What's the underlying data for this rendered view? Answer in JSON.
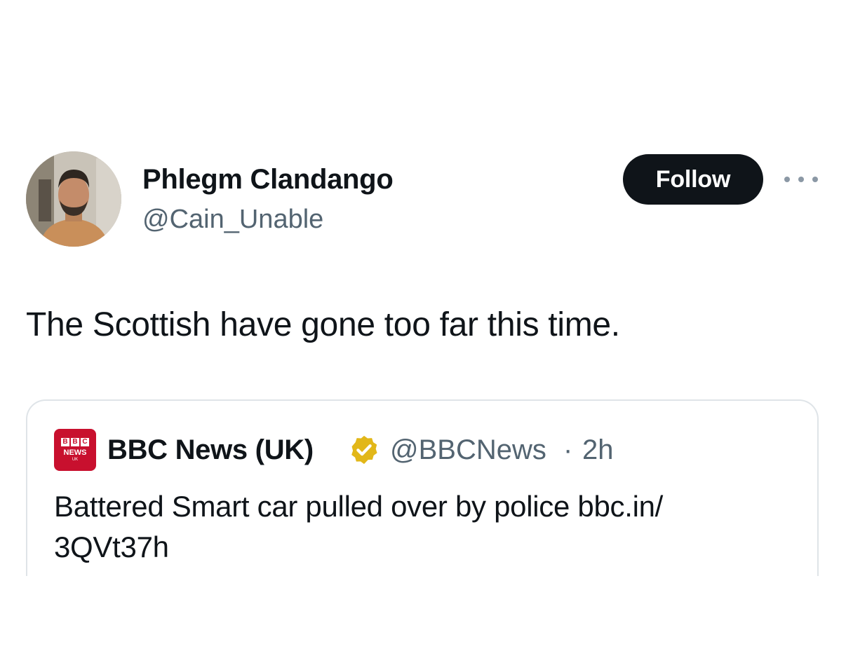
{
  "tweet": {
    "author": {
      "name": "Phlegm Clandango",
      "handle": "@Cain_Unable"
    },
    "follow_label": "Follow",
    "more_icon": "more-horizontal-icon",
    "text": "The Scottish have gone too far this time."
  },
  "quote": {
    "logo_text": {
      "blocks": [
        "B",
        "B",
        "C"
      ],
      "news": "NEWS",
      "region": "UK"
    },
    "author_name": "BBC News (UK)",
    "verified_icon": "verified-badge-icon",
    "handle": "@BBCNews",
    "separator": "·",
    "time": "2h",
    "text": "Battered Smart car pulled over by police bbc.in/ 3QVt37h"
  },
  "colors": {
    "text_primary": "#0f1419",
    "text_secondary": "#536471",
    "follow_bg": "#0f1419",
    "card_border": "#dfe4e8",
    "bbc_red": "#c8102e",
    "verified_gold": "#e2b719"
  }
}
